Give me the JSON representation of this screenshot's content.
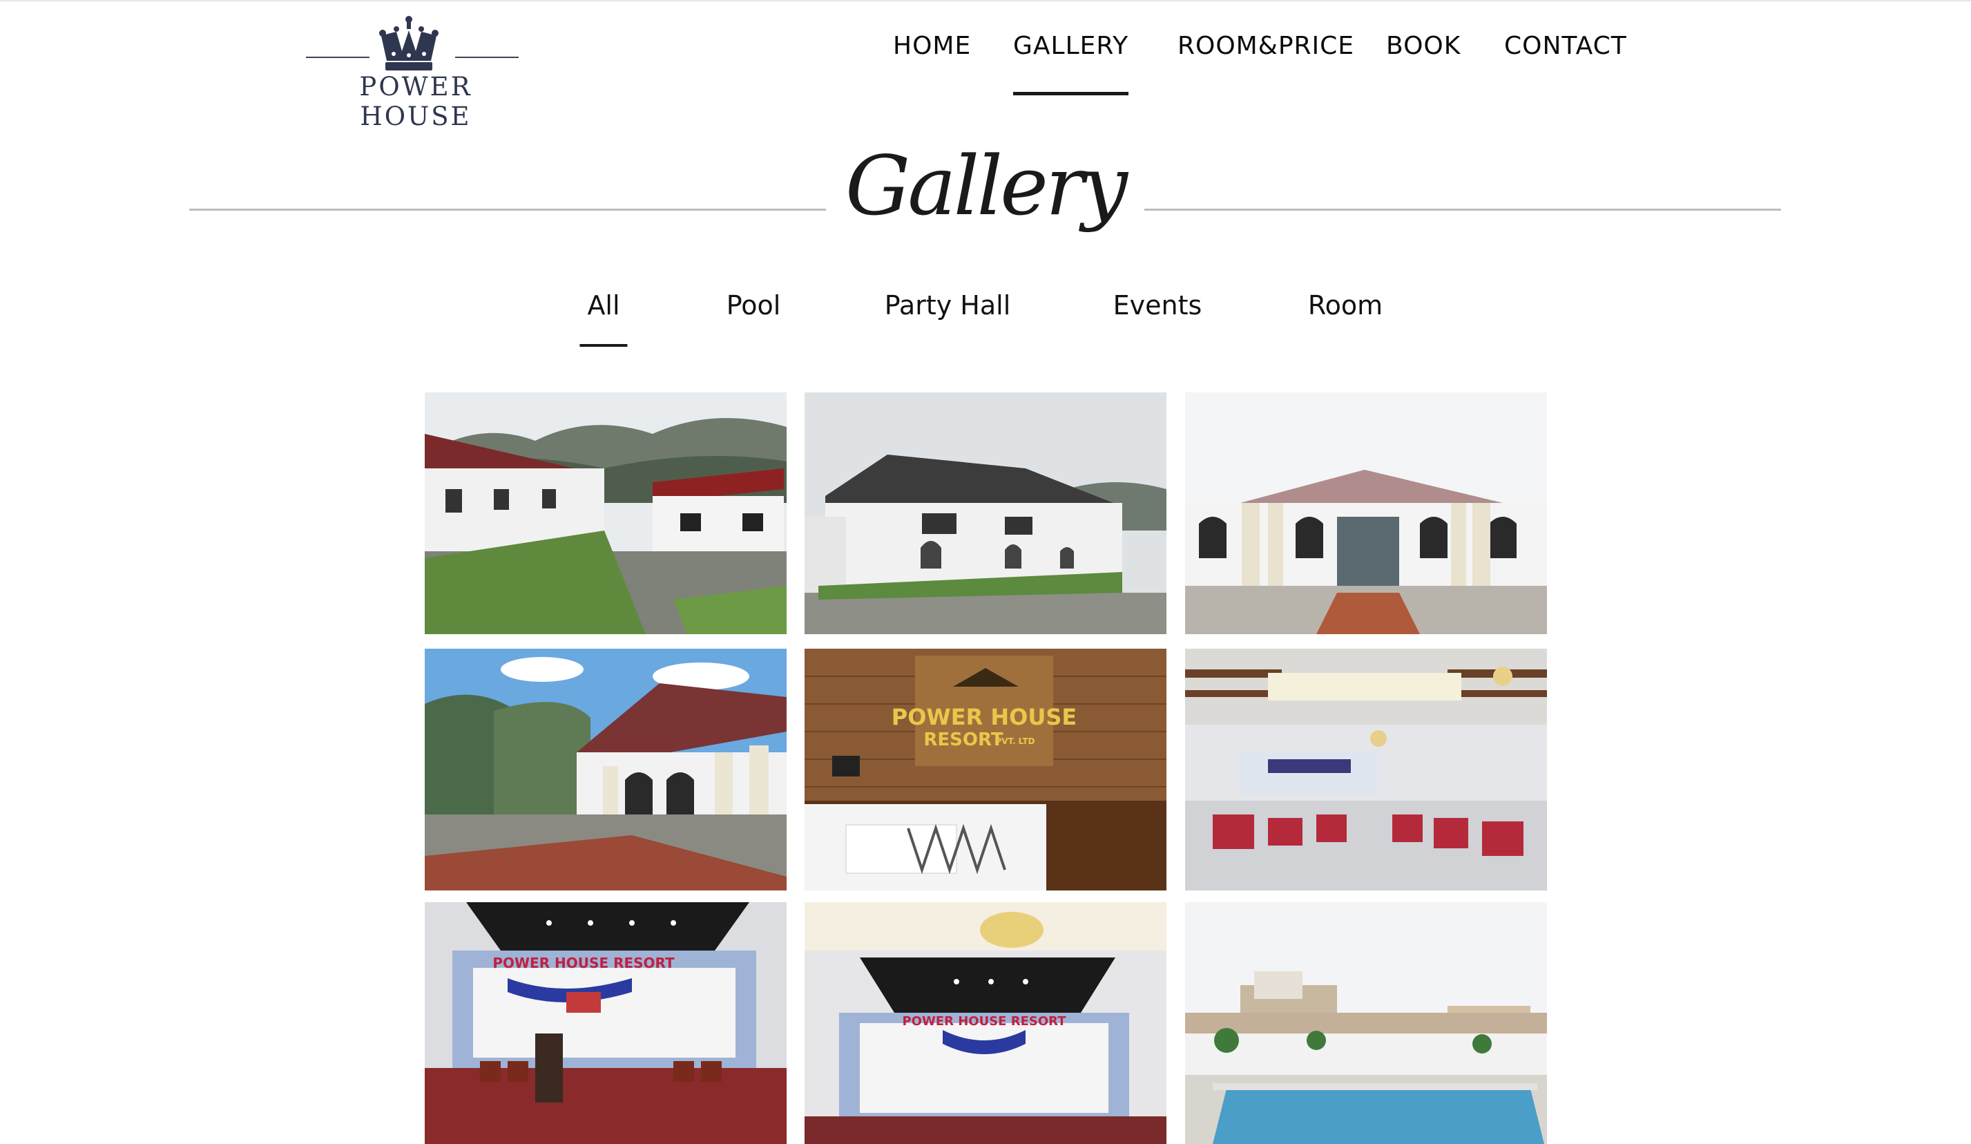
{
  "logo": {
    "text": "POWER HOUSE",
    "icon": "crown-icon",
    "color": "#2e3650"
  },
  "nav": {
    "items": [
      {
        "label": "HOME",
        "active": false
      },
      {
        "label": "GALLERY",
        "active": true
      },
      {
        "label": "ROOM&PRICE",
        "active": false
      },
      {
        "label": "BOOK",
        "active": false
      },
      {
        "label": "CONTACT",
        "active": false
      }
    ]
  },
  "gallery": {
    "title": "Gallery",
    "filters": [
      {
        "label": "All",
        "active": true
      },
      {
        "label": "Pool",
        "active": false
      },
      {
        "label": "Party Hall",
        "active": false
      },
      {
        "label": "Events",
        "active": false
      },
      {
        "label": "Room",
        "active": false
      }
    ],
    "photos": [
      {
        "subject": "resort-building-exterior"
      },
      {
        "subject": "resort-building-side"
      },
      {
        "subject": "party-hall-entrance"
      },
      {
        "subject": "party-hall-porch"
      },
      {
        "subject": "reception-desk",
        "sign_text": [
          "POWER HOUSE",
          "RESORT",
          "PVT. LTD"
        ]
      },
      {
        "subject": "banquet-hall-interior"
      },
      {
        "subject": "stage-hall",
        "banner_text": "POWER HOUSE RESORT"
      },
      {
        "subject": "stage-hall-chandelier",
        "banner_text": "POWER HOUSE RESORT"
      },
      {
        "subject": "swimming-pool"
      }
    ]
  },
  "colors": {
    "text": "#111111",
    "divider": "#bdbdbd",
    "brand": "#2e3650"
  }
}
